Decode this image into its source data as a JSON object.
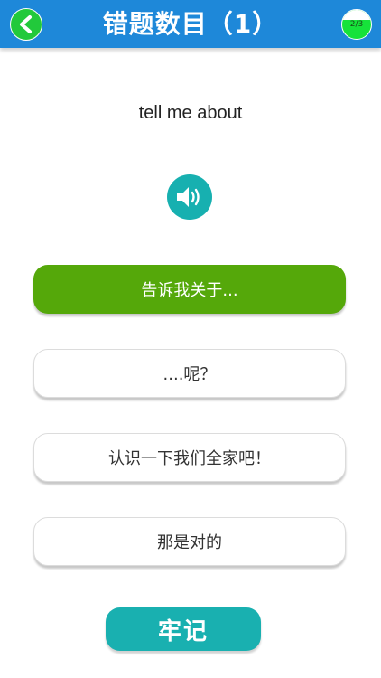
{
  "header": {
    "title": "错题数目（1）",
    "back_icon": "chevron-left-icon",
    "progress": {
      "text": "2/3",
      "fraction": 0.6667
    }
  },
  "question": {
    "word": "tell me about",
    "audio_icon": "speaker-icon"
  },
  "options": [
    {
      "label": "告诉我关于...",
      "state": "correct"
    },
    {
      "label": "....呢？",
      "state": "normal"
    },
    {
      "label": "认识一下我们全家吧！",
      "state": "normal"
    },
    {
      "label": "那是对的",
      "state": "normal"
    }
  ],
  "footer": {
    "remember_label": "牢记"
  },
  "colors": {
    "header_bg": "#1e88d9",
    "back_button": "#22c93b",
    "correct_option": "#55a80a",
    "accent_teal": "#19b0b0",
    "progress_fill": "#16e23a"
  }
}
